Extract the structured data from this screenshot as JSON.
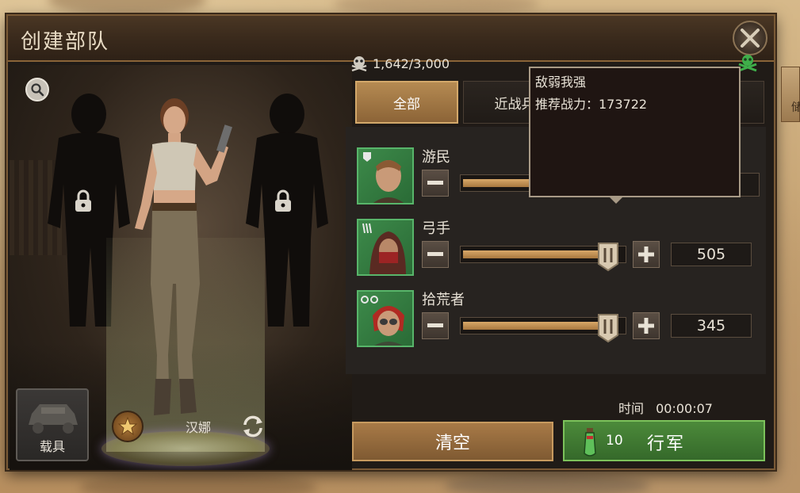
{
  "window": {
    "title": "创建部队"
  },
  "capacity": {
    "text": "1,642/3,000"
  },
  "tabs": [
    {
      "label": "全部",
      "active": true
    },
    {
      "label": "近战兵",
      "active": false
    }
  ],
  "units": [
    {
      "name": "游民",
      "slider_fraction": 0.93,
      "value": ""
    },
    {
      "name": "弓手",
      "slider_fraction": 0.93,
      "value": "505"
    },
    {
      "name": "拾荒者",
      "slider_fraction": 0.93,
      "value": "345"
    }
  ],
  "tooltip": {
    "title": "敌弱我强",
    "line": "推荐战力：173722"
  },
  "vehicle": {
    "label": "载具"
  },
  "hero": {
    "name": "汉娜"
  },
  "timer": {
    "label": "时间",
    "value": "00:00:07"
  },
  "actions": {
    "clear_label": "清空",
    "march_label": "行军",
    "march_cost": "10"
  },
  "side_tab": {
    "label": "储"
  },
  "colors": {
    "accent_green": "#4c8a3a",
    "accent_bronze": "#a87a47",
    "unit_green": "#3d8a4a"
  }
}
